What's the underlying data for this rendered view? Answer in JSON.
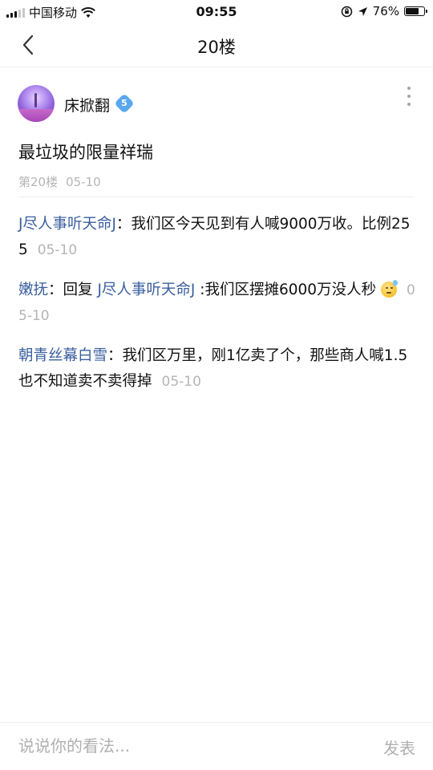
{
  "status_bar": {
    "carrier": "中国移动",
    "time": "09:55",
    "battery_text": "76%",
    "battery_level": 0.76
  },
  "nav": {
    "title": "20楼"
  },
  "post": {
    "username": "床掀翻",
    "level": "5",
    "content": "最垃圾的限量祥瑞",
    "floor": "第20楼",
    "date": "05-10"
  },
  "replies": [
    {
      "user": "J尽人事听天命J",
      "separator": "：",
      "text": "我们区今天见到有人喊9000万收。比例255",
      "date": "05-10"
    },
    {
      "user": "嫩抚",
      "separator": "：",
      "reply_prefix": "回复",
      "reply_to": "J尽人事听天命J",
      "text": ":我们区摆摊6000万没人秒",
      "emoji": "sweat-emoji-icon",
      "date": "05-10"
    },
    {
      "user": "朝青丝幕白雪",
      "separator": "：",
      "text": "我们区万里，刚1亿卖了个，那些商人喊1.5也不知道卖不卖得掉",
      "date": "05-10"
    }
  ],
  "bottom_bar": {
    "placeholder": "说说你的看法...",
    "send_label": "发表"
  },
  "colors": {
    "link_blue": "#3a5f9e",
    "meta_gray": "#b5b5b5",
    "badge_blue": "#5aa7ef"
  }
}
